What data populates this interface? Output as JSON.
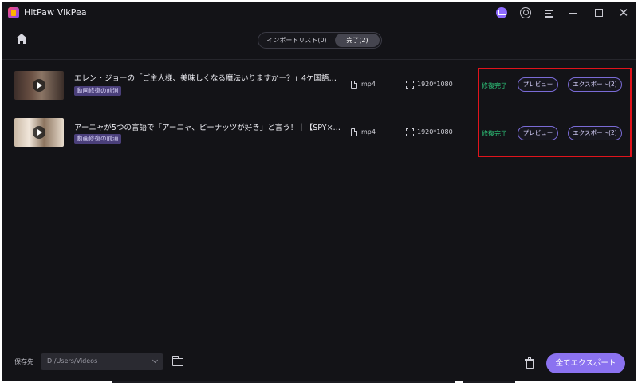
{
  "app": {
    "title": "HitPaw VikPea"
  },
  "titlebar": {
    "icons": [
      "cart-icon",
      "user-icon",
      "menu-icon",
      "minimize-icon",
      "maximize-icon",
      "close-icon"
    ],
    "close_glyph": "✕"
  },
  "header": {
    "tabs": [
      {
        "label": "インポートリスト(0)",
        "active": false
      },
      {
        "label": "完了(2)",
        "active": true
      }
    ]
  },
  "items": [
    {
      "title": "エレン・ジョーの「ご主人様、美味しくなる魔法いりますかー？」4ケ国語の吹替...",
      "tag": "動画修復の前消",
      "format": "mp4",
      "resolution": "1920*1080",
      "status": "修復完了",
      "preview_label": "プレビュー",
      "export_label": "エクスポート(2)"
    },
    {
      "title": "アーニャが5つの言語で「アーニャ、ピーナッツが好き」と言う！｜【SPY×FAMI...",
      "tag": "動画修復の前消",
      "format": "mp4",
      "resolution": "1920*1080",
      "status": "修復完了",
      "preview_label": "プレビュー",
      "export_label": "エクスポート(2)"
    }
  ],
  "footer": {
    "save_label": "保存先",
    "save_path": "D:/Users/Videos",
    "export_all_label": "全てエクスポート"
  },
  "colors": {
    "background": "#131317",
    "accent": "#8b72f0",
    "status_ok": "#2ec47a",
    "highlight": "#e0141c",
    "tag_bg": "#4a3f7a"
  }
}
